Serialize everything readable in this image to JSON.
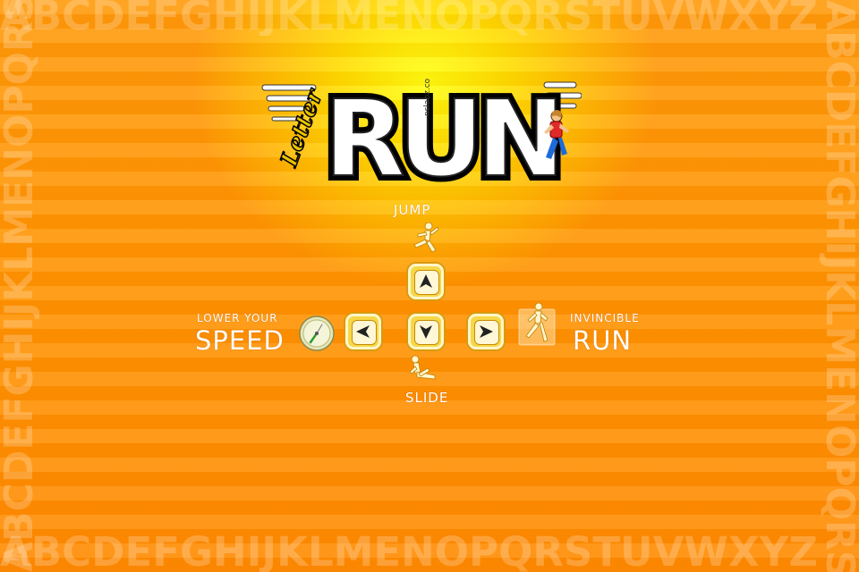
{
  "background_alphabet": {
    "top": "ABCDEFGHIJKLMENOPQRSTUVWXYZ",
    "bottom": "ABCDEFGHIJKLMENOPQRSTUVWXYZ",
    "left": "ABCDEFGHIJKLMENOPQRSTUVWXYZ",
    "right": "ABCDEFGHIJKLMENOPQRSTUVWXYZ"
  },
  "logo": {
    "script_word": "Letter",
    "main_word": "RUN",
    "credit": "nslabz.com"
  },
  "controls": {
    "jump": "JUMP",
    "slide": "SLIDE",
    "lower": "LOWER YOUR",
    "speed": "SPEED",
    "invincible": "INVINCIBLE",
    "run": "RUN"
  },
  "icons": {
    "up": "arrow-up-icon",
    "down": "arrow-down-icon",
    "left": "arrow-left-icon",
    "right": "arrow-right-icon",
    "speed": "speedometer-icon",
    "jump": "jumping-runner-icon",
    "slide": "sliding-runner-icon",
    "invincible": "invincible-runner-icon"
  },
  "colors": {
    "background": "#ff9300",
    "glow": "#ffff10",
    "key_fill": "#f5d84a",
    "text": "#ffffff"
  }
}
